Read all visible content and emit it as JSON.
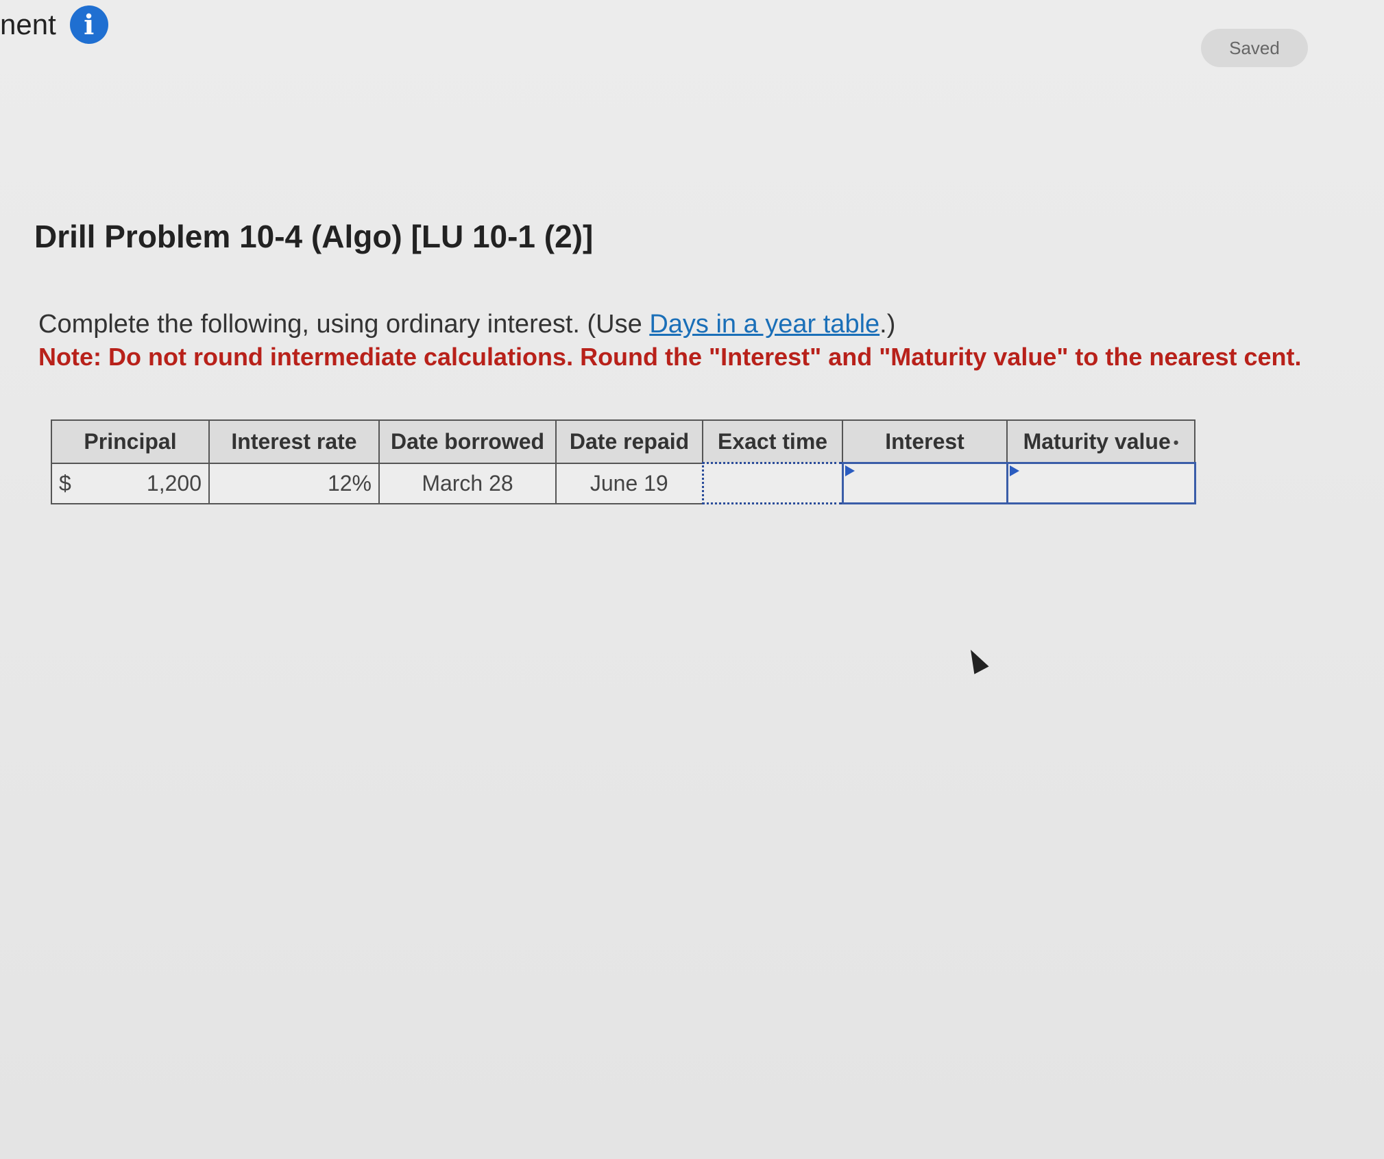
{
  "header": {
    "title_fragment": "nent",
    "info_icon": "info-icon",
    "saved_label": "Saved"
  },
  "problem": {
    "title": "Drill Problem 10-4 (Algo) [LU 10-1 (2)]",
    "instruction_prefix": "Complete the following, using ordinary interest. (Use ",
    "instruction_link": "Days in a year table",
    "instruction_suffix": ".)",
    "note": "Note: Do not round intermediate calculations. Round the \"Interest\" and \"Maturity value\" to the nearest cent."
  },
  "table": {
    "headers": {
      "principal": "Principal",
      "interest_rate": "Interest rate",
      "date_borrowed": "Date borrowed",
      "date_repaid": "Date repaid",
      "exact_time": "Exact time",
      "interest": "Interest",
      "maturity_value": "Maturity value"
    },
    "row": {
      "currency": "$",
      "principal": "1,200",
      "interest_rate": "12%",
      "date_borrowed": "March 28",
      "date_repaid": "June 19",
      "exact_time": "",
      "interest": "",
      "maturity_value": ""
    }
  },
  "colors": {
    "link": "#1a6fb8",
    "note": "#b8211a",
    "info_icon": "#1f6fd1",
    "input_border": "#3a5da8"
  }
}
